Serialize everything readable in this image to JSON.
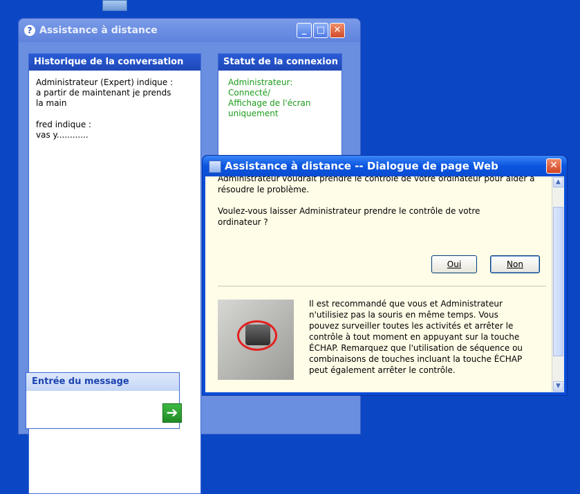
{
  "main_window": {
    "title": "Assistance à distance",
    "history": {
      "header": "Historique de la conversation",
      "entries": [
        "Administrateur (Expert) indique :\na partir de maintenant je prends\nla main",
        "fred indique :\nvas y............"
      ]
    },
    "status": {
      "header": "Statut de la connexion",
      "text": "Administrateur:\nConnecté/\nAffichage de l'écran\nuniquement"
    },
    "message": {
      "header": "Entrée du message"
    }
  },
  "dialog": {
    "title": "Assistance à distance -- Dialogue de page Web",
    "intro": "Administrateur voudrait prendre le contrôle de votre ordinateur pour aider à résoudre le problème.",
    "question": "Voulez-vous laisser Administrateur prendre le contrôle de votre ordinateur ?",
    "yes_label": "Oui",
    "no_label": "Non",
    "tip": "Il est recommandé que vous et Administrateur n'utilisiez pas la souris en même temps. Vous pouvez surveiller toutes les activités et arrêter le contrôle à tout moment en appuyant sur la touche ÉCHAP. Remarquez que l'utilisation de séquence ou combinaisons de touches incluant la touche ÉCHAP peut également arrêter le contrôle."
  },
  "icons": {
    "help": "help-icon",
    "send": "arrow-right-icon",
    "dialog": "web-dialog-icon",
    "picture": "keyboard-key-photo"
  },
  "colors": {
    "desktop": "#0b47c4",
    "status_text": "#1a9b1a",
    "dialog_background": "#fffce7",
    "title_bar": "#0b55e0"
  }
}
